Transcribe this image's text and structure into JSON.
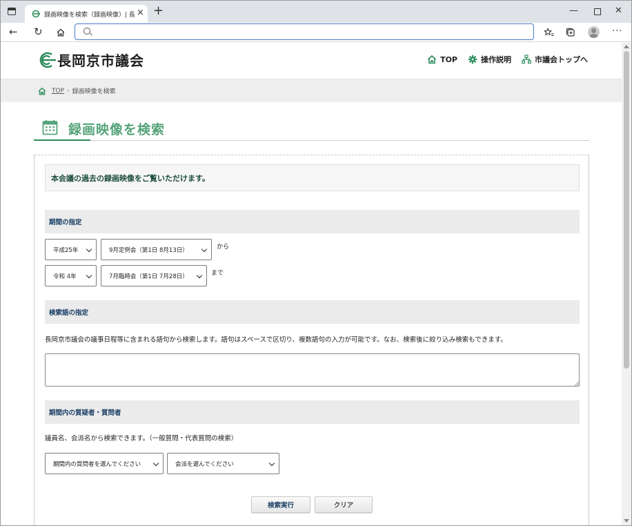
{
  "browser": {
    "tab_title": "録画映像を検索（録画映像）| 長",
    "address_value": "",
    "address_placeholder": ""
  },
  "site": {
    "logo_text": "長岡京市議会",
    "nav": [
      {
        "label": "TOP",
        "icon": "home-icon"
      },
      {
        "label": "操作説明",
        "icon": "gear-icon"
      },
      {
        "label": "市議会トップへ",
        "icon": "sitemap-icon"
      }
    ],
    "breadcrumb": {
      "home": "TOP",
      "separator": "›",
      "current": "録画映像を検索"
    },
    "page_title": "録画映像を検索"
  },
  "form": {
    "intro": "本会議の過去の録画映像をご覧いただけます。",
    "period": {
      "heading": "期間の指定",
      "from_era": "平成25年",
      "from_session": "9月定例会（第1日 8月13日）",
      "from_suffix": "から",
      "to_era": "令和 4年",
      "to_session": "7月臨時会（第1日 7月28日）",
      "to_suffix": "まで"
    },
    "keyword": {
      "heading": "検索語の指定",
      "description": "長岡京市議会の議事日程等に含まれる語句から検索します。語句はスペースで区切り、複数語句の入力が可能です。なお、検索後に絞り込み検索もできます。",
      "value": ""
    },
    "speaker": {
      "heading": "期間内の質疑者・質問者",
      "description": "議員名、会派名から検索できます。（一般質問・代表質問の検索）",
      "member_select": "期間内の質問者を選んでください",
      "faction_select": "会派を選んでください"
    },
    "buttons": {
      "search": "検索実行",
      "clear": "クリア"
    }
  },
  "colors": {
    "brand_green": "#2c8c5b",
    "title_green": "#55a37a",
    "heading_navy": "#1a3e66",
    "address_border": "#4a78c8"
  }
}
